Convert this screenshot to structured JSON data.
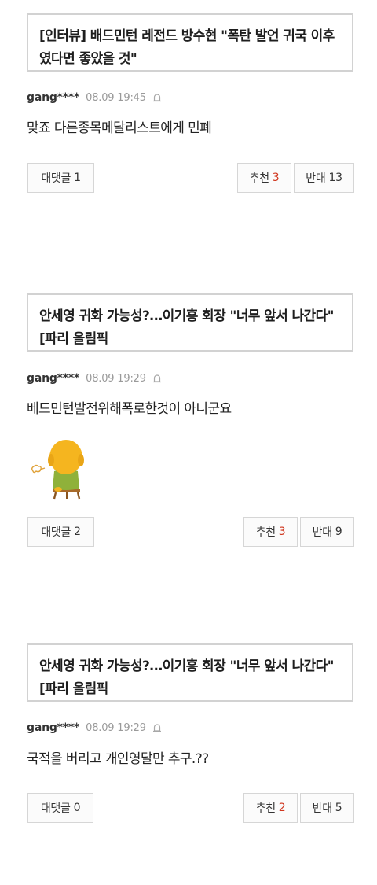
{
  "comments": [
    {
      "article_title": "[인터뷰] 배드민턴 레전드 방수현 \"폭탄 발언 귀국 이후였다면 좋았을 것\"",
      "user": "gang****",
      "date": "08.09 19:45",
      "text": "맞죠 다른종목메달리스트에게 민폐",
      "reply_label": "대댓글",
      "reply_count": "1",
      "recommend_label": "추천",
      "recommend_count": "3",
      "oppose_label": "반대",
      "oppose_count": "13"
    },
    {
      "article_title": "안세영 귀화 가능성?…이기흥 회장 \"너무 앞서 나간다\"[파리 올림픽",
      "user": "gang****",
      "date": "08.09 19:29",
      "text": "베드민턴발전위해폭로한것이 아니군요",
      "reply_label": "대댓글",
      "reply_count": "2",
      "recommend_label": "추천",
      "recommend_count": "3",
      "oppose_label": "반대",
      "oppose_count": "9"
    },
    {
      "article_title": "안세영 귀화 가능성?…이기흥 회장 \"너무 앞서 나간다\"[파리 올림픽",
      "user": "gang****",
      "date": "08.09 19:29",
      "text": "국적을 버리고 개인영달만 추구.??",
      "reply_label": "대댓글",
      "reply_count": "0",
      "recommend_label": "추천",
      "recommend_count": "2",
      "oppose_label": "반대",
      "oppose_count": "5"
    }
  ],
  "colors": {
    "recommend_count": "#d0361e",
    "border": "#d2d2d2",
    "date": "#9a9a9a"
  },
  "icons": {
    "report": "bell-report-icon",
    "sticker": "sulking-character-sticker"
  }
}
